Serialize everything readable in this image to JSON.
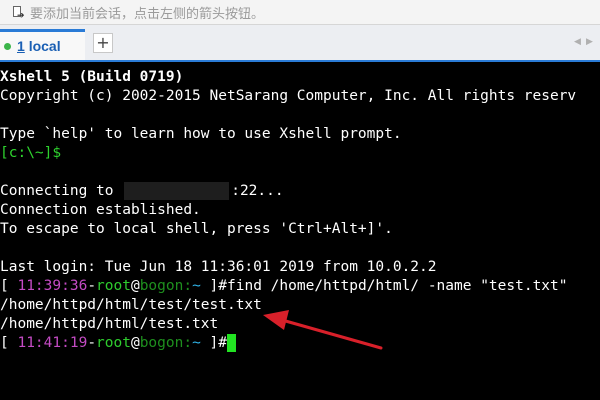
{
  "hint_bar": {
    "icon": "session-add-icon",
    "text": "要添加当前会话，点击左侧的箭头按钮。"
  },
  "tabs": [
    {
      "number": "1",
      "label": "local",
      "status_color": "#3cb54a"
    }
  ],
  "add_tab_label": "+",
  "nav": {
    "prev": "◀",
    "next": "▶"
  },
  "terminal": {
    "line1": "Xshell 5 (Build 0719)",
    "line2": "Copyright (c) 2002-2015 NetSarang Computer, Inc. All rights reserv",
    "line3": "Type `help' to learn how to use Xshell prompt.",
    "local_prompt": "[c:\\~]$",
    "connecting_prefix": "Connecting to ",
    "connecting_suffix": ":22...",
    "established": "Connection established.",
    "escape_hint": "To escape to local shell, press 'Ctrl+Alt+]'.",
    "last_login": "Last login: Tue Jun 18 11:36:01 2019 from 10.0.2.2",
    "prompt1": {
      "open": "[ ",
      "time": "11:39:36",
      "sep1": "-",
      "user": "root",
      "at": "@",
      "host": "bogon",
      "colon": ":",
      "dir": "~",
      "close": " ]#",
      "command": "find /home/httpd/html/ -name \"test.txt\""
    },
    "output1": "/home/httpd/html/test/test.txt",
    "output2": "/home/httpd/html/test.txt",
    "prompt2": {
      "open": "[ ",
      "time": "11:41:19",
      "sep1": "-",
      "user": "root",
      "at": "@",
      "host": "bogon",
      "colon": ":",
      "dir": "~",
      "close": " ]#"
    }
  },
  "annotation_color": "#d8202a"
}
